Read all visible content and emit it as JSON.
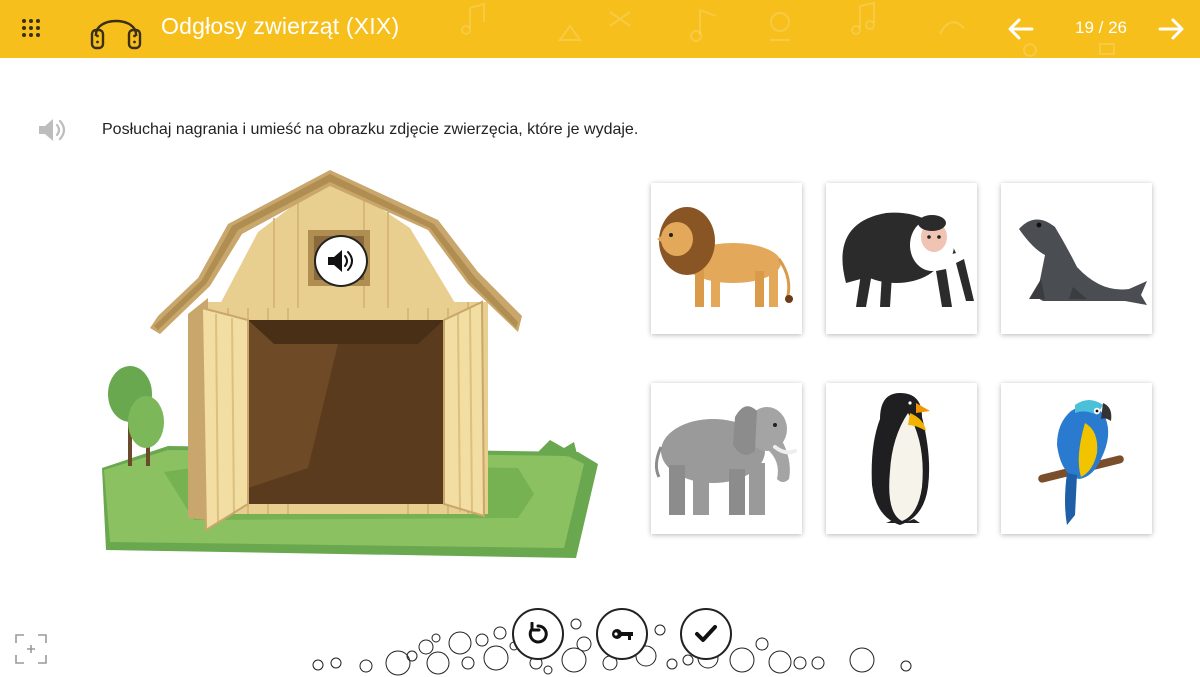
{
  "header": {
    "title": "Odgłosy zwierząt (XIX)",
    "page_counter": "19 / 26",
    "background_color": "#f6bf1c",
    "icons": [
      "grid-menu-icon",
      "headphones-icon",
      "arrow-left-icon",
      "arrow-right-icon"
    ]
  },
  "instruction": {
    "text": "Posłuchaj nagrania i umieść na obrazku zdjęcie zwierzęcia, które je wydaje.",
    "icon": "speaker-icon"
  },
  "scene": {
    "description_icon": "barn-icon",
    "audio_button_icon": "speaker-icon"
  },
  "cards": [
    {
      "animal": "lion",
      "icon": "lion-icon"
    },
    {
      "animal": "monkey",
      "icon": "monkey-icon"
    },
    {
      "animal": "seal",
      "icon": "seal-icon"
    },
    {
      "animal": "elephant",
      "icon": "elephant-icon"
    },
    {
      "animal": "penguin",
      "icon": "penguin-icon"
    },
    {
      "animal": "parrot",
      "icon": "parrot-icon"
    }
  ],
  "controls": [
    {
      "name": "reset",
      "icon": "reset-icon"
    },
    {
      "name": "show-answer",
      "icon": "key-icon"
    },
    {
      "name": "check",
      "icon": "checkmark-icon"
    }
  ],
  "fullscreen": {
    "icon": "fullscreen-icon"
  }
}
